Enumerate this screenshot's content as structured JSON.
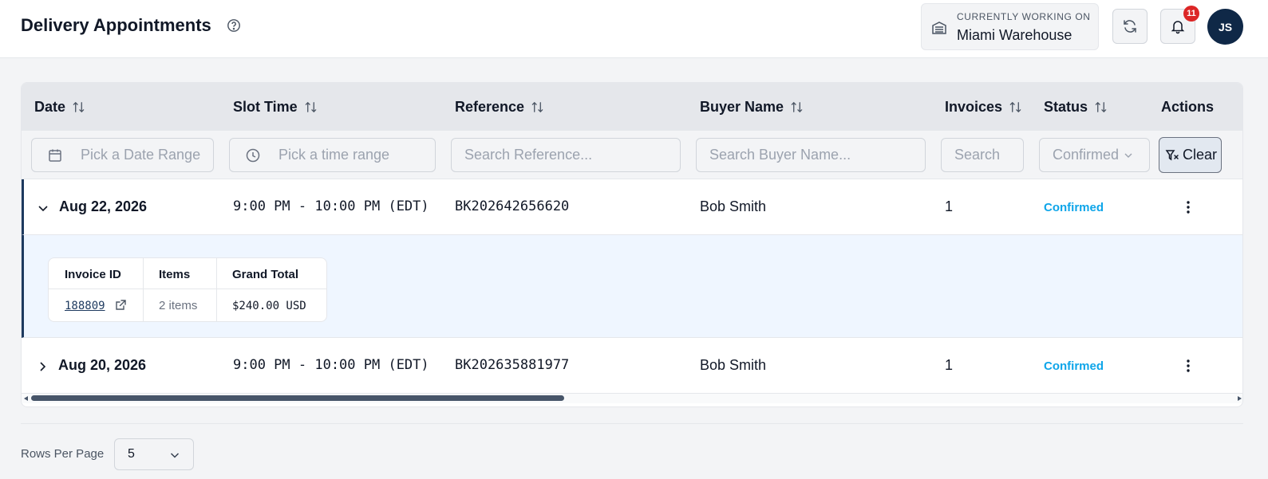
{
  "header": {
    "title": "Delivery Appointments",
    "location_label": "CURRENTLY WORKING ON",
    "location_value": "Miami Warehouse",
    "notification_count": "11",
    "avatar_initials": "JS"
  },
  "table": {
    "columns": [
      "Date",
      "Slot Time",
      "Reference",
      "Buyer Name",
      "Invoices",
      "Status",
      "Actions"
    ],
    "filters": {
      "date_placeholder": "Pick a Date Range",
      "time_placeholder": "Pick a time range",
      "reference_placeholder": "Search Reference...",
      "buyer_placeholder": "Search Buyer Name...",
      "invoices_placeholder": "Search",
      "status_value": "Confirmed",
      "clear_label": "Clear"
    },
    "rows": [
      {
        "date": "Aug 22, 2026",
        "slot": "9:00 PM - 10:00 PM (EDT)",
        "reference": "BK202642656620",
        "buyer": "Bob Smith",
        "invoices": "1",
        "status": "Confirmed",
        "expanded": true,
        "details": {
          "columns": [
            "Invoice ID",
            "Items",
            "Grand Total"
          ],
          "invoice_id": "188809",
          "items": "2 items",
          "grand_total": "$240.00 USD"
        }
      },
      {
        "date": "Aug 20, 2026",
        "slot": "9:00 PM - 10:00 PM (EDT)",
        "reference": "BK202635881977",
        "buyer": "Bob Smith",
        "invoices": "1",
        "status": "Confirmed",
        "expanded": false
      }
    ]
  },
  "footer": {
    "rows_per_page_label": "Rows Per Page",
    "rows_per_page_value": "5"
  },
  "colors": {
    "accent_navy": "#0f2847",
    "status_confirmed": "#0ea5e9",
    "badge_red": "#dc2626",
    "expanded_bg": "#eff6ff"
  }
}
